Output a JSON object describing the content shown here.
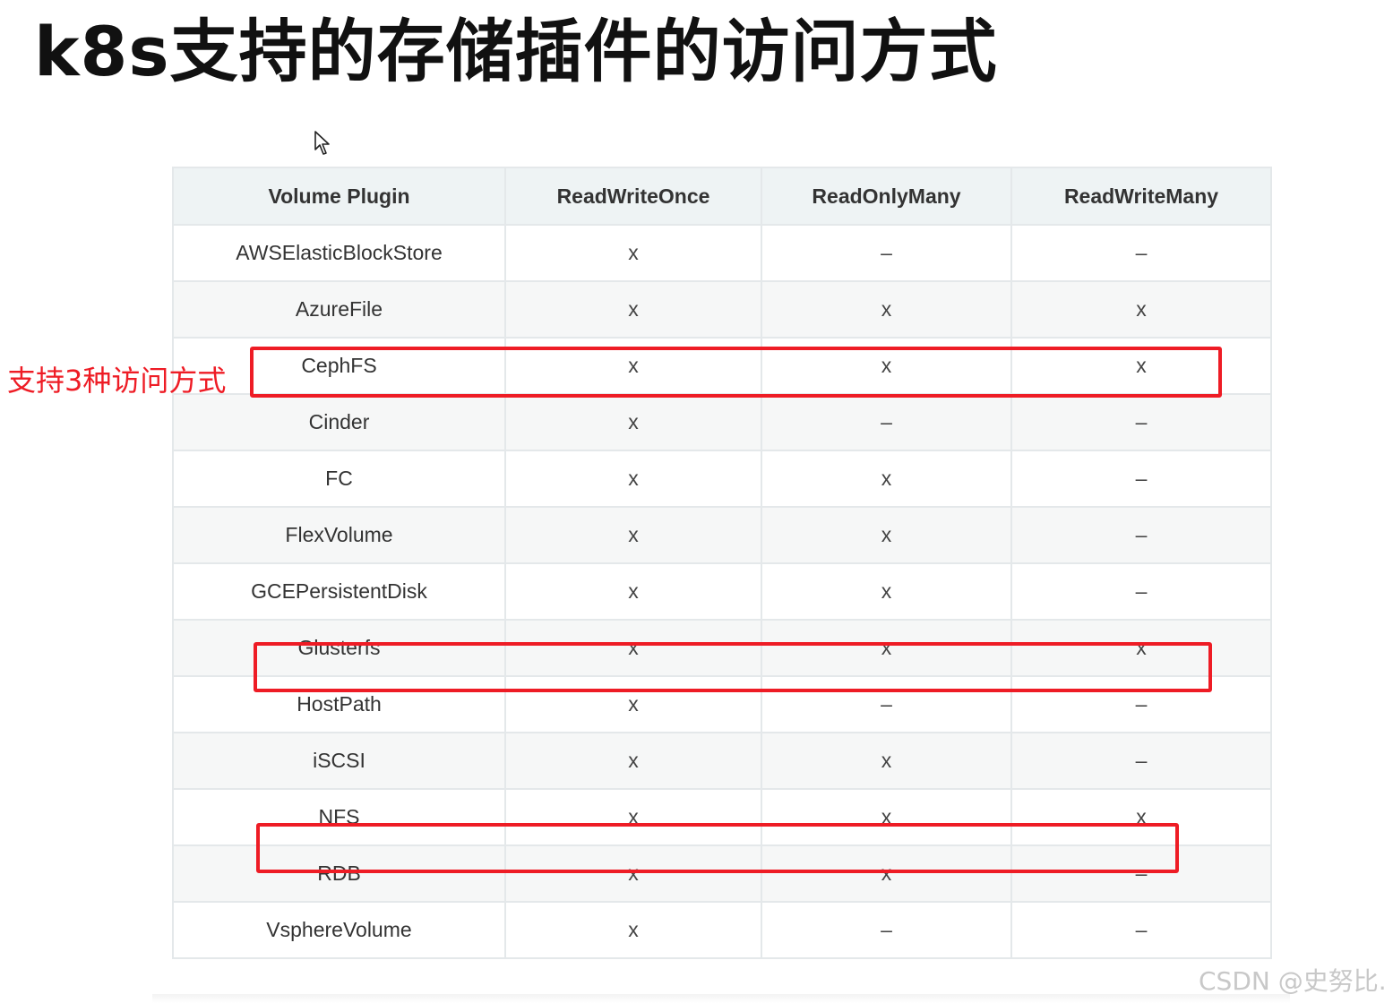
{
  "title": "k8s支持的存储插件的访问方式",
  "annotation": "支持3种访问方式",
  "watermark": "CSDN @史努比.",
  "table": {
    "headers": [
      "Volume Plugin",
      "ReadWriteOnce",
      "ReadOnlyMany",
      "ReadWriteMany"
    ],
    "rows": [
      [
        "AWSElasticBlockStore",
        "x",
        "–",
        "–"
      ],
      [
        "AzureFile",
        "x",
        "x",
        "x"
      ],
      [
        "CephFS",
        "x",
        "x",
        "x"
      ],
      [
        "Cinder",
        "x",
        "–",
        "–"
      ],
      [
        "FC",
        "x",
        "x",
        "–"
      ],
      [
        "FlexVolume",
        "x",
        "x",
        "–"
      ],
      [
        "GCEPersistentDisk",
        "x",
        "x",
        "–"
      ],
      [
        "Glusterfs",
        "x",
        "x",
        "x"
      ],
      [
        "HostPath",
        "x",
        "–",
        "–"
      ],
      [
        "iSCSI",
        "x",
        "x",
        "–"
      ],
      [
        "NFS",
        "x",
        "x",
        "x"
      ],
      [
        "RDB",
        "x",
        "x",
        "–"
      ],
      [
        "VsphereVolume",
        "x",
        "–",
        "–"
      ]
    ]
  },
  "highlighted_rows": [
    "CephFS",
    "Glusterfs",
    "NFS"
  ],
  "colors": {
    "highlight": "#ee1c25",
    "header_bg": "#eef3f4",
    "row_alt_bg": "#f6f7f7",
    "border": "#e4e8ea"
  },
  "icons": {
    "cursor": "mouse-pointer-icon"
  }
}
